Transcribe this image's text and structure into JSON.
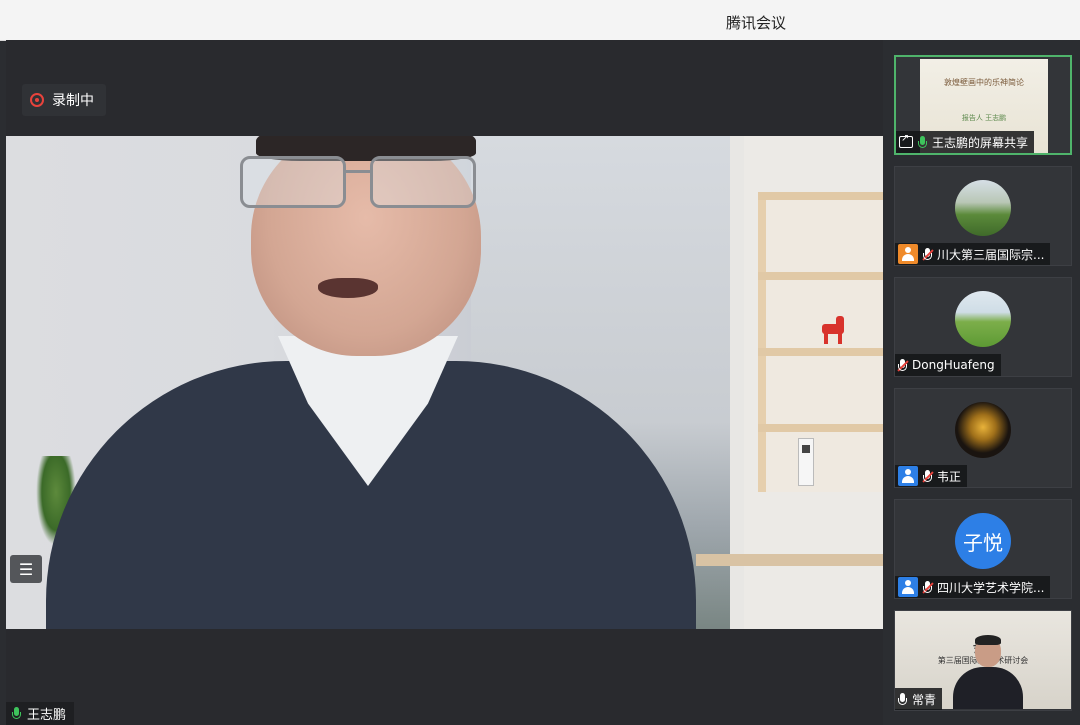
{
  "window": {
    "title": "腾讯会议"
  },
  "recording": {
    "label": "录制中"
  },
  "main_speaker": {
    "name": "王志鹏"
  },
  "sidebar": {
    "tiles": [
      {
        "id": "screen-share",
        "label": "王志鹏的屏幕共享",
        "slide_title": "敦煌壁画中的乐神简论",
        "slide_sub": "报告人 王志鹏",
        "active": true
      },
      {
        "id": "chuanda",
        "label": "川大第三届国际宗...",
        "avatar": "landscape-garden",
        "icon_color": "#ef8a2a",
        "muted": true
      },
      {
        "id": "donghuafeng",
        "label": "DongHuafeng",
        "avatar": "green-field",
        "muted": true
      },
      {
        "id": "weizheng",
        "label": "韦正",
        "avatar": "golden-horse",
        "icon_color": "#2d7fe6",
        "muted": true
      },
      {
        "id": "sichuan-art",
        "label": "四川大学艺术学院...",
        "avatar_text": "子悦",
        "icon_color": "#2d7fe6",
        "muted": true
      },
      {
        "id": "changqing",
        "label": "常青",
        "banner_line1": "艺术",
        "banner_line2": "第三届国际宗 学术研讨会"
      }
    ]
  },
  "colors": {
    "accent_green": "#3ec45c",
    "record_red": "#e8433c",
    "avatar_blue": "#2d7fe6"
  }
}
